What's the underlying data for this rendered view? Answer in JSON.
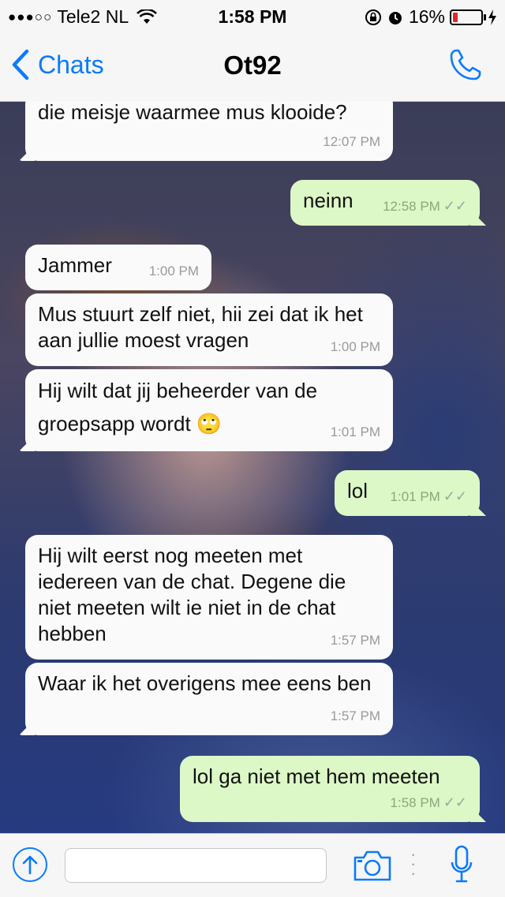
{
  "status_bar": {
    "signal": "●●●○○",
    "carrier": "Tele2 NL",
    "time": "1:58 PM",
    "battery": "16%"
  },
  "nav": {
    "back_label": "Chats",
    "title": "Ot92"
  },
  "messages": [
    {
      "direction": "in",
      "text": "die meisje waarmee mus klooide?",
      "time": "12:07 PM"
    },
    {
      "direction": "out",
      "text": "neinn",
      "time": "12:58 PM"
    },
    {
      "direction": "in",
      "text": "Jammer",
      "time": "1:00 PM"
    },
    {
      "direction": "in",
      "text": "Mus stuurt zelf niet, hii zei dat ik het aan jullie moest vragen",
      "time": "1:00 PM"
    },
    {
      "direction": "in",
      "text": "Hij wilt dat jij beheerder van de groepsapp wordt 🙄",
      "time": "1:01 PM"
    },
    {
      "direction": "out",
      "text": "lol",
      "time": "1:01 PM"
    },
    {
      "direction": "in",
      "text": "Hij wilt eerst nog meeten met iedereen van de chat. Degene die niet meeten wilt ie niet in de chat hebben",
      "time": "1:57 PM"
    },
    {
      "direction": "in",
      "text": "Waar ik het overigens mee eens ben",
      "time": "1:57 PM"
    },
    {
      "direction": "out",
      "text": "lol ga niet met hem meeten",
      "time": "1:58 PM"
    }
  ],
  "input": {
    "value": "",
    "placeholder": ""
  },
  "icons": {
    "back": "chevron-left-icon",
    "call": "phone-icon",
    "upload": "arrow-up-circle-icon",
    "camera": "camera-icon",
    "mic": "microphone-icon"
  },
  "colors": {
    "accent": "#0a7afe",
    "incoming_bubble": "#fafafa",
    "outgoing_bubble": "#dcf8c6",
    "battery_low": "#e0262b"
  }
}
